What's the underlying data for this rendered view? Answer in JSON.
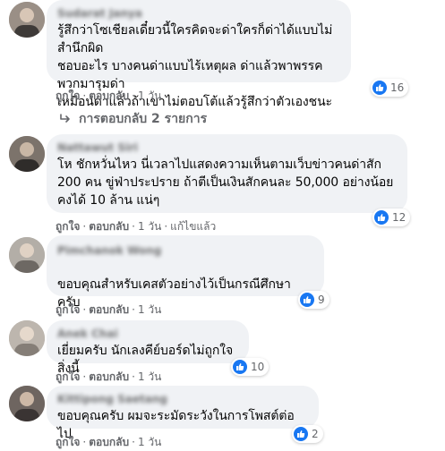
{
  "comments": [
    {
      "author": "Sudarat Janya",
      "text": "รู้สึกว่าโซเชียลเดี๋ยวนี้ใครคิดจะด่าใครก็ด่าได้แบบไม่สำนึกผิด\nชอบอะไร บางคนด่าแบบไร้เหตุผล ด่าแล้วพาพรรคพวกมารุมด่า\nเหมือนด่าแล้วถ้าเขาไม่ตอบโต้แล้วรู้สึกว่าตัวเองชนะ",
      "reactions": "16",
      "like": "ถูกใจ",
      "reply": "ตอบกลับ",
      "time": "1 วัน",
      "replies_label": "การตอบกลับ 2 รายการ",
      "avatar_color": "#8a7f78"
    },
    {
      "author": "Nattawut Siri",
      "text": "โห ชักหวั่นไหว นี่เวลาไปแสดงความเห็นตามเว็บข่าวคนด่าสัก\n200 คน ขู่ฟ่าประปราย ถ้าตีเป็นเงินสักคนละ 50,000 อย่างน้อย\nคงได้ 10 ล้าน แน่ๆ",
      "reactions": "12",
      "like": "ถูกใจ",
      "reply": "ตอบกลับ",
      "time": "1 วัน",
      "edited": "แก้ไขแล้ว",
      "avatar_color": "#6b625b"
    },
    {
      "author": "Pimchanok Wong",
      "text": "ขอบคุณสำหรับเคสตัวอย่างไว้เป็นกรณีศึกษาครับ",
      "reactions": "9",
      "like": "ถูกใจ",
      "reply": "ตอบกลับ",
      "time": "1 วัน",
      "avatar_color": "#9c9892"
    },
    {
      "author": "Anek Chai",
      "text": "เยี่ยมครับ นักเลงคีย์บอร์ดไม่ถูกใจสิ่งนี้",
      "reactions": "10",
      "like": "ถูกใจ",
      "reply": "ตอบกลับ",
      "time": "1 วัน",
      "avatar_color": "#a9a39c"
    },
    {
      "author": "Kittipong Saetang",
      "text": "ขอบคุณครับ ผมจะระมัดระวังในการโพสต์ต่อไป",
      "reactions": "2",
      "like": "ถูกใจ",
      "reply": "ตอบกลับ",
      "time": "1 วัน",
      "avatar_color": "#5f5753"
    }
  ]
}
